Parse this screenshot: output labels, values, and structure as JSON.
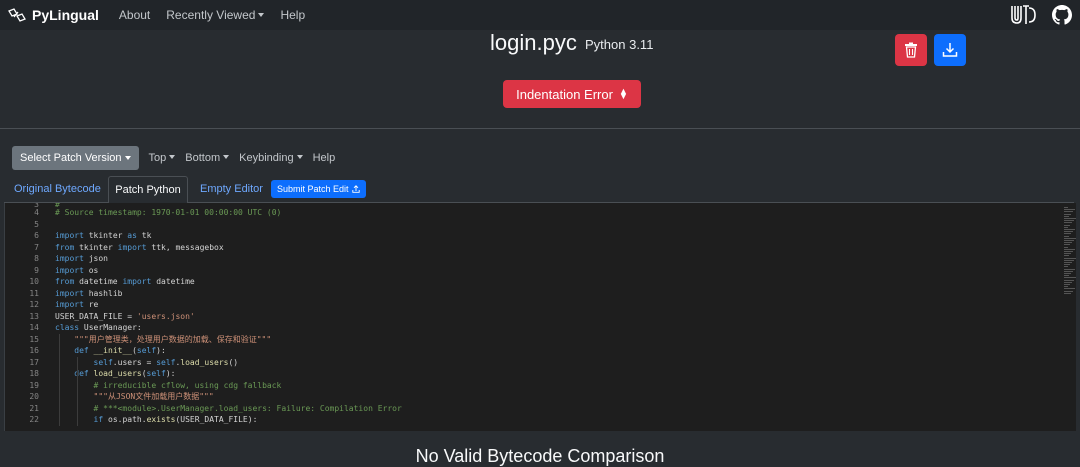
{
  "nav": {
    "brand": "PyLingual",
    "links": [
      "About",
      "Recently Viewed",
      "Help"
    ]
  },
  "file": {
    "name": "login.pyc",
    "python_version": "Python 3.11"
  },
  "error_select": "Indentation Error",
  "toolbar": {
    "select_patch": "Select Patch Version",
    "top": "Top",
    "bottom": "Bottom",
    "keybinding": "Keybinding",
    "help": "Help"
  },
  "tabs": {
    "original": "Original Bytecode",
    "patch": "Patch Python",
    "empty": "Empty Editor",
    "submit": "Submit Patch Edit"
  },
  "code": [
    {
      "n": "4",
      "t": "# Source timestamp: 1970-01-01 00:00:00 UTC (0)"
    },
    {
      "n": "5",
      "t": ""
    },
    {
      "n": "6",
      "t": "import tkinter as tk"
    },
    {
      "n": "7",
      "t": "from tkinter import ttk, messagebox"
    },
    {
      "n": "8",
      "t": "import json"
    },
    {
      "n": "9",
      "t": "import os"
    },
    {
      "n": "10",
      "t": "from datetime import datetime"
    },
    {
      "n": "11",
      "t": "import hashlib"
    },
    {
      "n": "12",
      "t": "import re"
    },
    {
      "n": "13",
      "t": "USER_DATA_FILE = 'users.json'"
    },
    {
      "n": "14",
      "t": "class UserManager:"
    },
    {
      "n": "15",
      "t": "    \"\"\"用户管理类，处理用户数据的加载、保存和验证\"\"\""
    },
    {
      "n": "16",
      "t": "    def __init__(self):"
    },
    {
      "n": "17",
      "t": "        self.users = self.load_users()"
    },
    {
      "n": "18",
      "t": "    def load_users(self):"
    },
    {
      "n": "19",
      "t": "        # irreducible cflow, using cdg fallback"
    },
    {
      "n": "20",
      "t": "        \"\"\"从JSON文件加载用户数据\"\"\""
    },
    {
      "n": "21",
      "t": "        # ***<module>.UserManager.load_users: Failure: Compilation Error"
    },
    {
      "n": "22",
      "t": "        if os.path.exists(USER_DATA_FILE):"
    }
  ],
  "bottom_title": "No Valid Bytecode Comparison"
}
